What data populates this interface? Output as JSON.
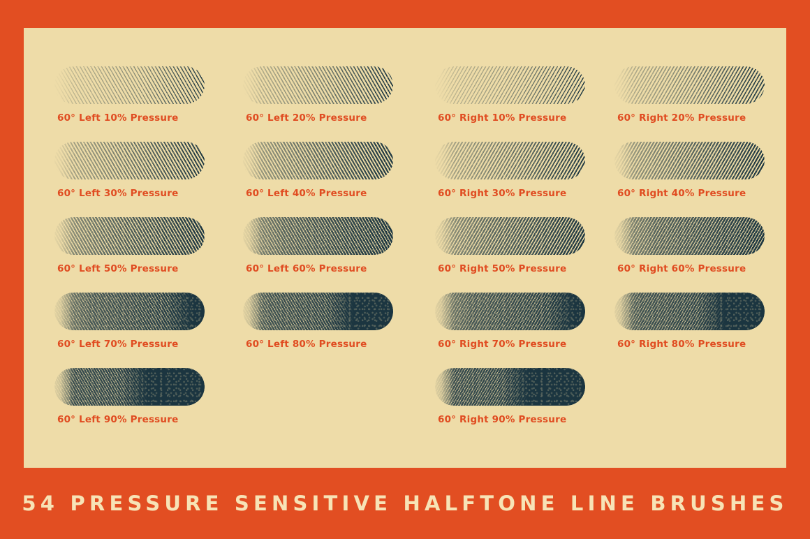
{
  "poster": {
    "background_color": "#E24E22",
    "panel_color": "#EEDCA8",
    "ink_color": "#1B3540",
    "caption_color": "#E04C21",
    "banner_text_color": "#F7E3B6"
  },
  "banner": {
    "title": "54 PRESSURE SENSITIVE HALFTONE LINE BRUSHES"
  },
  "swatches": [
    {
      "label": "60° Left 10% Pressure",
      "direction": "left",
      "pressure": 10,
      "angle": "60°",
      "col": 0,
      "row": 0
    },
    {
      "label": "60° Left 20% Pressure",
      "direction": "left",
      "pressure": 20,
      "angle": "60°",
      "col": 1,
      "row": 0
    },
    {
      "label": "60° Right 10% Pressure",
      "direction": "right",
      "pressure": 10,
      "angle": "60°",
      "col": 2,
      "row": 0
    },
    {
      "label": "60° Right 20% Pressure",
      "direction": "right",
      "pressure": 20,
      "angle": "60°",
      "col": 3,
      "row": 0
    },
    {
      "label": "60° Left 30% Pressure",
      "direction": "left",
      "pressure": 30,
      "angle": "60°",
      "col": 0,
      "row": 1
    },
    {
      "label": "60° Left 40% Pressure",
      "direction": "left",
      "pressure": 40,
      "angle": "60°",
      "col": 1,
      "row": 1
    },
    {
      "label": "60° Right 30% Pressure",
      "direction": "right",
      "pressure": 30,
      "angle": "60°",
      "col": 2,
      "row": 1
    },
    {
      "label": "60° Right 40% Pressure",
      "direction": "right",
      "pressure": 40,
      "angle": "60°",
      "col": 3,
      "row": 1
    },
    {
      "label": "60° Left 50% Pressure",
      "direction": "left",
      "pressure": 50,
      "angle": "60°",
      "col": 0,
      "row": 2
    },
    {
      "label": "60° Left 60% Pressure",
      "direction": "left",
      "pressure": 60,
      "angle": "60°",
      "col": 1,
      "row": 2
    },
    {
      "label": "60° Right 50% Pressure",
      "direction": "right",
      "pressure": 50,
      "angle": "60°",
      "col": 2,
      "row": 2
    },
    {
      "label": "60° Right 60% Pressure",
      "direction": "right",
      "pressure": 60,
      "angle": "60°",
      "col": 3,
      "row": 2
    },
    {
      "label": "60° Left 70% Pressure",
      "direction": "left",
      "pressure": 70,
      "angle": "60°",
      "col": 0,
      "row": 3
    },
    {
      "label": "60° Left 80% Pressure",
      "direction": "left",
      "pressure": 80,
      "angle": "60°",
      "col": 1,
      "row": 3
    },
    {
      "label": "60° Right 70% Pressure",
      "direction": "right",
      "pressure": 70,
      "angle": "60°",
      "col": 2,
      "row": 3
    },
    {
      "label": "60° Right 80% Pressure",
      "direction": "right",
      "pressure": 80,
      "angle": "60°",
      "col": 3,
      "row": 3
    },
    {
      "label": "60° Left 90% Pressure",
      "direction": "left",
      "pressure": 90,
      "angle": "60°",
      "col": 0,
      "row": 4
    },
    {
      "label": "60° Right 90% Pressure",
      "direction": "right",
      "pressure": 90,
      "angle": "60°",
      "col": 2,
      "row": 4
    }
  ]
}
